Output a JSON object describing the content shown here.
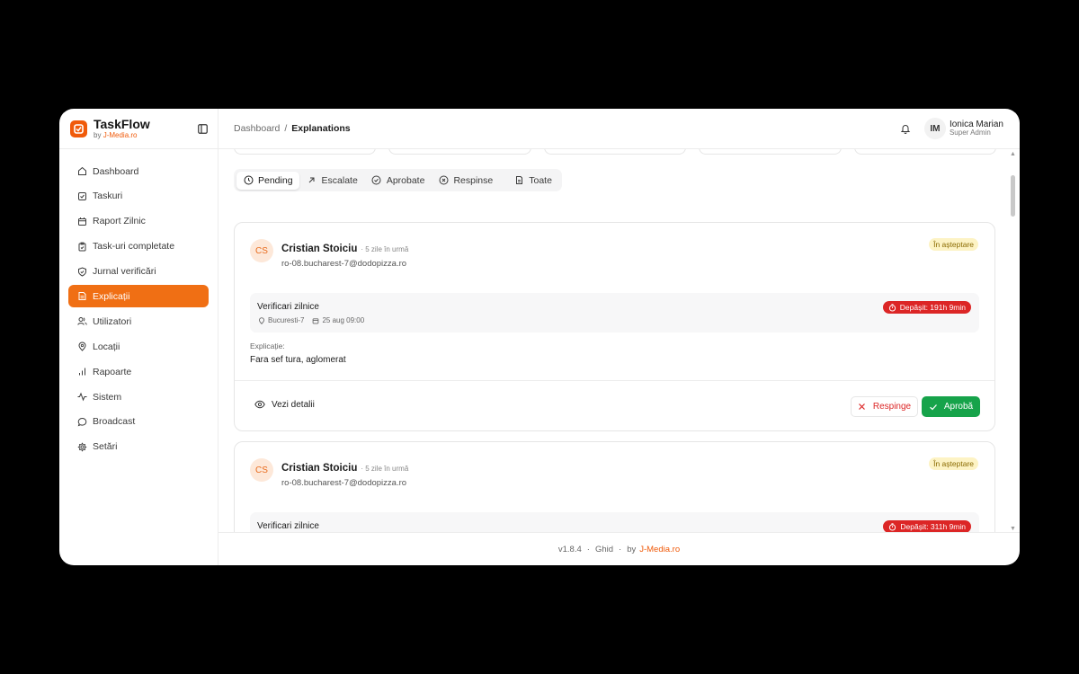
{
  "brand": {
    "name": "TaskFlow",
    "by": "by",
    "by_accent": "J-Media.ro"
  },
  "sidebar": {
    "items": [
      {
        "label": "Dashboard",
        "icon": "home-icon"
      },
      {
        "label": "Taskuri",
        "icon": "checkbox-icon"
      },
      {
        "label": "Raport Zilnic",
        "icon": "calendar-icon"
      },
      {
        "label": "Task-uri completate",
        "icon": "clipboard-check-icon"
      },
      {
        "label": "Jurnal verificări",
        "icon": "shield-icon"
      },
      {
        "label": "Explicații",
        "icon": "file-text-icon",
        "active": true
      },
      {
        "label": "Utilizatori",
        "icon": "users-icon"
      },
      {
        "label": "Locații",
        "icon": "map-pin-icon"
      },
      {
        "label": "Rapoarte",
        "icon": "bar-chart-icon"
      },
      {
        "label": "Sistem",
        "icon": "activity-icon"
      },
      {
        "label": "Broadcast",
        "icon": "message-icon"
      },
      {
        "label": "Setări",
        "icon": "gear-icon"
      }
    ]
  },
  "header": {
    "breadcrumb_root": "Dashboard",
    "breadcrumb_sep": "/",
    "breadcrumb_current": "Explanations",
    "user_initials": "IM",
    "user_name": "Ionica Marian",
    "user_role": "Super Admin"
  },
  "tabs": [
    {
      "label": "Pending",
      "icon": "clock-icon",
      "active": true
    },
    {
      "label": "Escalate",
      "icon": "arrow-up-right-icon"
    },
    {
      "label": "Aprobate",
      "icon": "check-circle-icon"
    },
    {
      "label": "Respinse",
      "icon": "x-circle-icon"
    },
    {
      "label": "Toate",
      "icon": "file-icon"
    }
  ],
  "cards": [
    {
      "initials": "CS",
      "name": "Cristian Stoiciu",
      "time": "· 5 zile în urmă",
      "email": "ro-08.bucharest-7@dodopizza.ro",
      "status": "În așteptare",
      "task_title": "Verificari zilnice",
      "location": "Bucuresti-7",
      "date": "25 aug 09:00",
      "overdue": "Depășit: 191h 9min",
      "explanation_label": "Explicație:",
      "explanation": "Fara sef tura, aglomerat",
      "view_label": "Vezi detalii",
      "reject_label": "Respinge",
      "approve_label": "Aprobă"
    },
    {
      "initials": "CS",
      "name": "Cristian Stoiciu",
      "time": "· 5 zile în urmă",
      "email": "ro-08.bucharest-7@dodopizza.ro",
      "status": "În așteptare",
      "task_title": "Verificari zilnice",
      "overdue": "Depășit: 311h 9min"
    }
  ],
  "footer": {
    "version": "v1.8.4",
    "guide": "Ghid",
    "by": "by",
    "by_accent": "J-Media.ro"
  },
  "colors": {
    "accent": "#f06f14",
    "danger": "#dc2626",
    "success": "#16a34a",
    "pending_bg": "#fdf3c4"
  }
}
